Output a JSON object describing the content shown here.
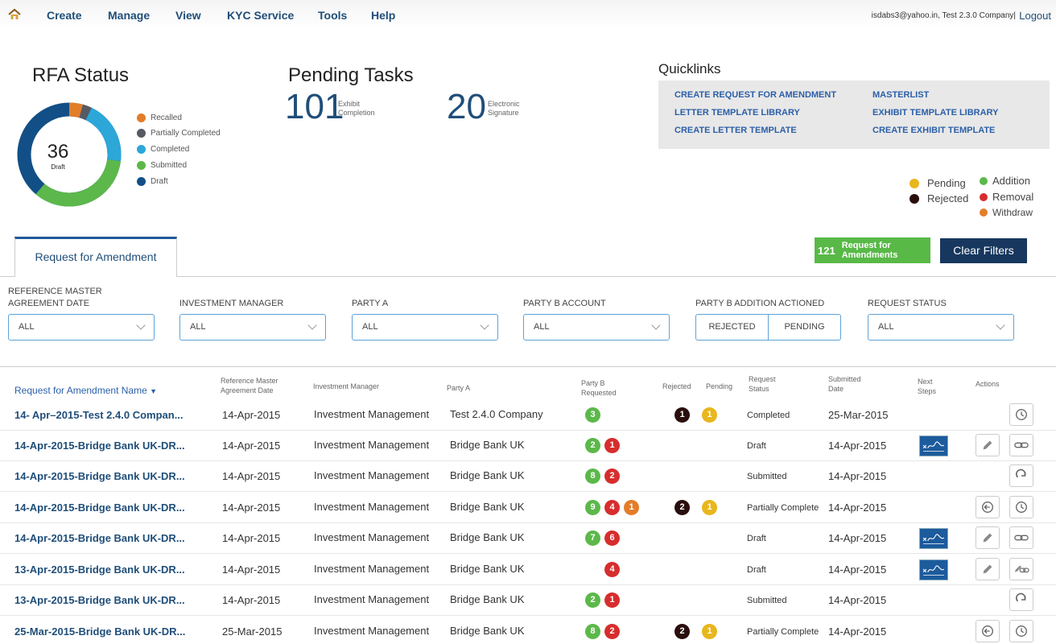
{
  "nav": {
    "items": [
      "Create",
      "Manage",
      "View",
      "KYC Service",
      "Tools",
      "Help"
    ],
    "user": "isdabs3@yahoo.in, Test 2.3.0 Company|",
    "logout": "Logout"
  },
  "rfa_status": {
    "title": "RFA Status",
    "center_value": "36",
    "center_label": "Draft",
    "legend": [
      {
        "label": "Recalled",
        "color": "#e27d2a"
      },
      {
        "label": "Partially Completed",
        "color": "#555a63"
      },
      {
        "label": "Completed",
        "color": "#2ca7d8"
      },
      {
        "label": "Submitted",
        "color": "#5cb84a"
      },
      {
        "label": "Draft",
        "color": "#124f86"
      }
    ]
  },
  "pending": {
    "title": "Pending Tasks",
    "exhibit_count": "101",
    "exhibit_label_1": "Exhibit",
    "exhibit_label_2": "Completion",
    "esign_count": "20",
    "esign_label_1": "Electronic",
    "esign_label_2": "Signature"
  },
  "quicklinks": {
    "title": "Quicklinks",
    "links": [
      "CREATE REQUEST FOR AMENDMENT",
      "LETTER TEMPLATE LIBRARY",
      "CREATE LETTER TEMPLATE",
      "MASTERLIST",
      "EXHIBIT TEMPLATE LIBRARY",
      "CREATE EXHIBIT TEMPLATE"
    ]
  },
  "key": {
    "pending": "Pending",
    "rejected": "Rejected",
    "addition": "Addition",
    "removal": "Removal",
    "withdraw": "Withdraw"
  },
  "tab": {
    "label": "Request for Amendment"
  },
  "count_button": {
    "count": "121",
    "label_1": "Request for",
    "label_2": "Amendments"
  },
  "clear_filters": "Clear Filters",
  "filters": {
    "ref_date_1": "REFERENCE MASTER",
    "ref_date_2": "AGREEMENT DATE",
    "investment_manager": "INVESTMENT MANAGER",
    "party_a": "PARTY A",
    "party_b_account": "PARTY B ACCOUNT",
    "party_b_addition": "PARTY B ADDITION ACTIONED",
    "request_status": "REQUEST STATUS",
    "all": "ALL",
    "rejected": "REJECTED",
    "pending": "PENDING"
  },
  "table": {
    "headers": {
      "name": "Request for Amendment Name",
      "ref_1": "Reference Master",
      "ref_2": "Agreement Date",
      "im": "Investment Manager",
      "party_a": "Party A",
      "pb_1": "Party B",
      "pb_2": "Requested",
      "rejected": "Rejected",
      "pending": "Pending",
      "rs_1": "Request",
      "rs_2": "Status",
      "sd_1": "Submitted",
      "sd_2": "Date",
      "ns_1": "Next",
      "ns_2": "Steps",
      "actions": "Actions"
    },
    "rows": [
      {
        "name": "14- Apr–2015-Test 2.4.0 Compan...",
        "ref": "14-Apr-2015",
        "im": "Investment Management",
        "party_a": "Test 2.4.0 Company",
        "add": "3",
        "rem": "",
        "wd": "",
        "rej": "1",
        "pen": "1",
        "status": "Completed",
        "date": "25-Mar-2015"
      },
      {
        "name": "14-Apr-2015-Bridge Bank UK-DR...",
        "ref": "14-Apr-2015",
        "im": "Investment Management",
        "party_a": "Bridge Bank UK",
        "add": "2",
        "rem": "1",
        "wd": "",
        "rej": "",
        "pen": "",
        "status": "Draft",
        "date": "14-Apr-2015"
      },
      {
        "name": "14-Apr-2015-Bridge Bank UK-DR...",
        "ref": "14-Apr-2015",
        "im": "Investment Management",
        "party_a": "Bridge Bank UK",
        "add": "8",
        "rem": "2",
        "wd": "",
        "rej": "",
        "pen": "",
        "status": "Submitted",
        "date": "14-Apr-2015"
      },
      {
        "name": "14-Apr-2015-Bridge Bank UK-DR...",
        "ref": "14-Apr-2015",
        "im": "Investment Management",
        "party_a": "Bridge Bank UK",
        "add": "9",
        "rem": "4",
        "wd": "1",
        "rej": "2",
        "pen": "1",
        "status": "Partially Complete",
        "date": "14-Apr-2015"
      },
      {
        "name": "14-Apr-2015-Bridge Bank UK-DR...",
        "ref": "14-Apr-2015",
        "im": "Investment Management",
        "party_a": "Bridge Bank UK",
        "add": "7",
        "rem": "6",
        "wd": "",
        "rej": "",
        "pen": "",
        "status": "Draft",
        "date": "14-Apr-2015"
      },
      {
        "name": "13-Apr-2015-Bridge Bank UK-DR...",
        "ref": "14-Apr-2015",
        "im": "Investment Management",
        "party_a": "Bridge Bank UK",
        "add": "",
        "rem": "4",
        "wd": "",
        "rej": "",
        "pen": "",
        "status": "Draft",
        "date": "14-Apr-2015"
      },
      {
        "name": "13-Apr-2015-Bridge Bank UK-DR...",
        "ref": "14-Apr-2015",
        "im": "Investment Management",
        "party_a": "Bridge Bank UK",
        "add": "2",
        "rem": "1",
        "wd": "",
        "rej": "",
        "pen": "",
        "status": "Submitted",
        "date": "14-Apr-2015"
      },
      {
        "name": "25-Mar-2015-Bridge Bank UK-DR...",
        "ref": "25-Mar-2015",
        "im": "Investment Management",
        "party_a": "Bridge Bank UK",
        "add": "8",
        "rem": "2",
        "wd": "",
        "rej": "2",
        "pen": "1",
        "status": "Partially Complete",
        "date": "14-Apr-2015"
      }
    ]
  }
}
